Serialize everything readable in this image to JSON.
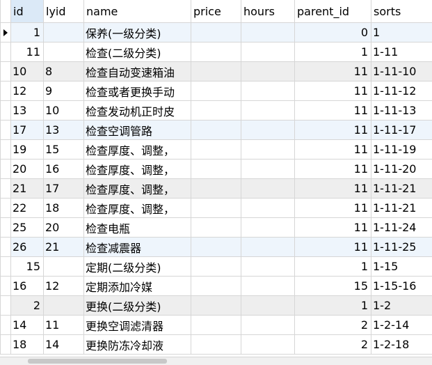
{
  "columns": [
    "id",
    "lyid",
    "name",
    "price",
    "hours",
    "parent_id",
    "sorts"
  ],
  "rows": [
    {
      "id": "1",
      "lyid": "",
      "name": "保养(一级分类)",
      "price": "",
      "hours": "",
      "parent_id": "0",
      "sorts": "1"
    },
    {
      "id": "11",
      "lyid": "",
      "name": "检查(二级分类)",
      "price": "",
      "hours": "",
      "parent_id": "1",
      "sorts": "1-11"
    },
    {
      "id": "10",
      "lyid": "8",
      "name": "检查自动变速箱油",
      "price": "",
      "hours": "",
      "parent_id": "11",
      "sorts": "1-11-10"
    },
    {
      "id": "12",
      "lyid": "9",
      "name": "检查或者更换手动",
      "price": "",
      "hours": "",
      "parent_id": "11",
      "sorts": "1-11-12"
    },
    {
      "id": "13",
      "lyid": "10",
      "name": "检查发动机正时皮",
      "price": "",
      "hours": "",
      "parent_id": "11",
      "sorts": "1-11-13"
    },
    {
      "id": "17",
      "lyid": "13",
      "name": "检查空调管路",
      "price": "",
      "hours": "",
      "parent_id": "11",
      "sorts": "1-11-17"
    },
    {
      "id": "19",
      "lyid": "15",
      "name": "检查厚度、调整，",
      "price": "",
      "hours": "",
      "parent_id": "11",
      "sorts": "1-11-19"
    },
    {
      "id": "20",
      "lyid": "16",
      "name": "检查厚度、调整，",
      "price": "",
      "hours": "",
      "parent_id": "11",
      "sorts": "1-11-20"
    },
    {
      "id": "21",
      "lyid": "17",
      "name": "检查厚度、调整，",
      "price": "",
      "hours": "",
      "parent_id": "11",
      "sorts": "1-11-21"
    },
    {
      "id": "22",
      "lyid": "18",
      "name": "检查厚度、调整，",
      "price": "",
      "hours": "",
      "parent_id": "11",
      "sorts": "1-11-21"
    },
    {
      "id": "25",
      "lyid": "20",
      "name": "检查电瓶",
      "price": "",
      "hours": "",
      "parent_id": "11",
      "sorts": "1-11-24"
    },
    {
      "id": "26",
      "lyid": "21",
      "name": "检查减震器",
      "price": "",
      "hours": "",
      "parent_id": "11",
      "sorts": "1-11-25"
    },
    {
      "id": "15",
      "lyid": "",
      "name": "定期(二级分类)",
      "price": "",
      "hours": "",
      "parent_id": "1",
      "sorts": "1-15"
    },
    {
      "id": "16",
      "lyid": "12",
      "name": "定期添加冷媒",
      "price": "",
      "hours": "",
      "parent_id": "15",
      "sorts": "1-15-16"
    },
    {
      "id": "2",
      "lyid": "",
      "name": "更换(二级分类)",
      "price": "",
      "hours": "",
      "parent_id": "1",
      "sorts": "1-2"
    },
    {
      "id": "14",
      "lyid": "11",
      "name": "更换空调滤清器",
      "price": "",
      "hours": "",
      "parent_id": "2",
      "sorts": "1-2-14"
    },
    {
      "id": "18",
      "lyid": "14",
      "name": "更换防冻冷却液",
      "price": "",
      "hours": "",
      "parent_id": "2",
      "sorts": "1-2-18"
    }
  ],
  "alt_rows": [
    2,
    8,
    14
  ],
  "sel_rows": [
    0,
    5,
    11
  ],
  "sorted_column": "id"
}
